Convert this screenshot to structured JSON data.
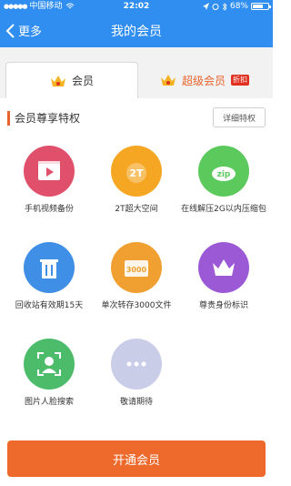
{
  "status_bar": {
    "carrier": "中国移动",
    "time": "22:02",
    "battery": "68%",
    "battery_level": 0.68
  },
  "nav": {
    "back_label": "更多",
    "title": "我的会员"
  },
  "tabs": [
    {
      "label": "会员",
      "icon": "crown-icon",
      "selected": true
    },
    {
      "label": "超级会员",
      "icon": "crown-icon",
      "badge": "折扣",
      "selected": false
    }
  ],
  "section": {
    "title": "会员尊享特权",
    "detail_button": "详细特权"
  },
  "features": [
    {
      "label": "手机视频备份",
      "icon": "video-icon",
      "color": "#e0506a"
    },
    {
      "label": "2T超大空间",
      "icon": "2t-medal-icon",
      "color": "#f5a623",
      "icon_text": "2T"
    },
    {
      "label": "在线解压2G以内压缩包",
      "icon": "zip-cloud-icon",
      "color": "#5cc95c",
      "icon_text": "zip"
    },
    {
      "label": "回收站有效期15天",
      "icon": "trash-icon",
      "color": "#3f8fe6"
    },
    {
      "label": "单次转存3000文件",
      "icon": "folder-3000-icon",
      "color": "#f0a030",
      "icon_text": "3000"
    },
    {
      "label": "尊贵身份标识",
      "icon": "crown-icon",
      "color": "#9b59d6"
    },
    {
      "label": "图片人脸搜索",
      "icon": "face-scan-icon",
      "color": "#4cbc6a"
    },
    {
      "label": "敬请期待",
      "icon": "more-dots-icon",
      "color": "#c9cde8"
    }
  ],
  "cta": {
    "label": "开通会员",
    "color": "#ee6a2c"
  }
}
